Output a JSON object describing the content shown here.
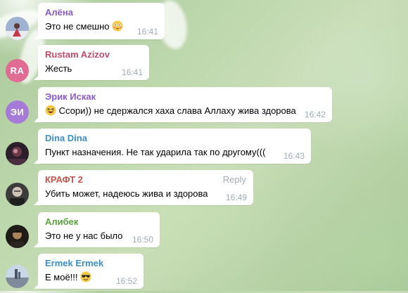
{
  "colors": {
    "sender_alena": "#8a5bc9",
    "sender_rustam": "#c64a68",
    "sender_erik": "#8a5bc9",
    "sender_dina": "#3a8fc7",
    "sender_kraft": "#c9524a",
    "sender_alibek": "#5aa33c",
    "sender_ermek": "#3a8fc7",
    "avatar_ra": "#e06b93",
    "avatar_ei": "#a67ad8",
    "time": "#a0acb6"
  },
  "messages": [
    {
      "sender": "Алёна",
      "text": "Это не смешно",
      "emoji": "flushed-face-icon",
      "time": "16:41"
    },
    {
      "sender": "Rustam Azizov",
      "avatar_initials": "RA",
      "text": "Жесть",
      "time": "16:41"
    },
    {
      "sender": "Эрик Искак",
      "avatar_initials": "ЭИ",
      "emoji": "grinning-squint-face-icon",
      "text": "Ссори)) не сдержался хаха слава Аллаху жива здорова",
      "time": "16:42"
    },
    {
      "sender": "Dina Dina",
      "text": "Пункт назначения. Не так ударила так по другому(((",
      "time": "16:43"
    },
    {
      "sender": "КРАФТ 2",
      "text": "Убить может, надеюсь жива и здорова",
      "time": "16:49",
      "reply_label": "Reply"
    },
    {
      "sender": "Алибек",
      "text": "Это не у нас было",
      "time": "16:50"
    },
    {
      "sender": "Ermek Ermek",
      "text": "Е моё!!!",
      "emoji": "sunglasses-face-icon",
      "time": "16:52"
    }
  ]
}
